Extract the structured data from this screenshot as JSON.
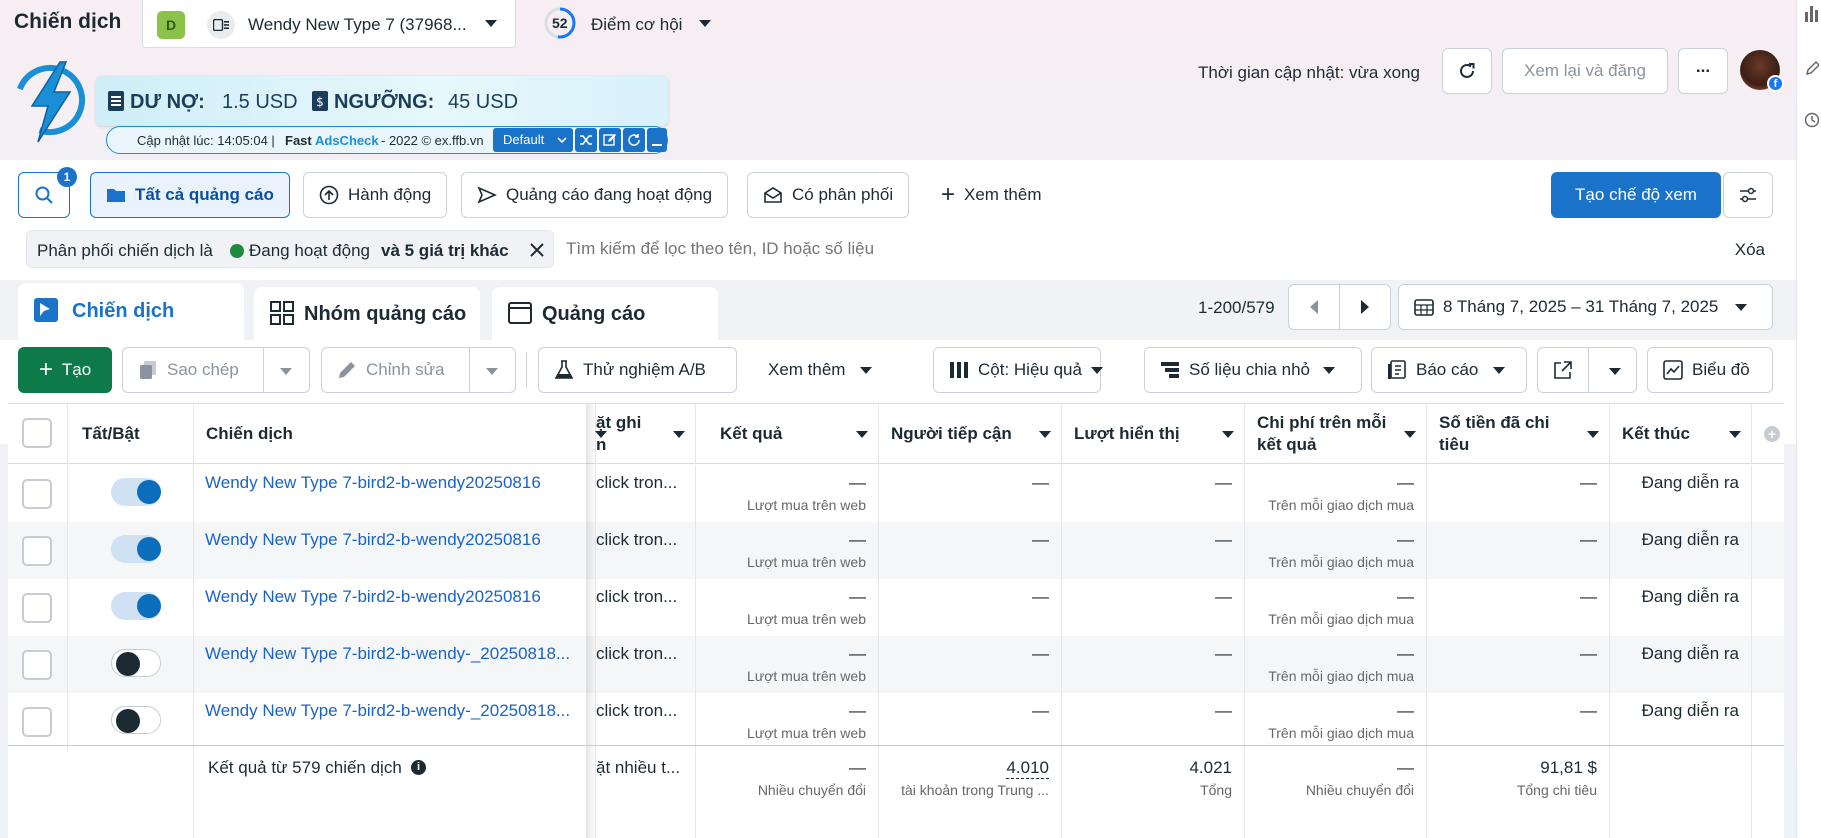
{
  "header": {
    "title": "Chiến dịch",
    "account_initial": "D",
    "account_name": "Wendy New Type 7 (37968...",
    "opportunity_score": "52",
    "opportunity_label": "Điểm cơ hội",
    "update_time": "Thời gian cập nhật: vừa xong",
    "review_publish": "Xem lại và đăng",
    "more": "..."
  },
  "adscheck": {
    "debt_label": "DƯ NỢ:",
    "debt_value": "1.5 USD",
    "threshold_label": "NGƯỠNG:",
    "threshold_value": "45 USD",
    "updated": "Cập nhật lúc: 14:05:04 |",
    "brand_fast": "Fast",
    "brand_ads": "AdsCheck",
    "brand_rest": "- 2022 © ex.ffb.vn",
    "preset": "Default"
  },
  "filters": {
    "search_badge": "1",
    "all_ads": "Tất cả quảng cáo",
    "actions": "Hành động",
    "active_ads": "Quảng cáo đang hoạt động",
    "delivering": "Có phân phối",
    "see_more": "Xem thêm",
    "create_view": "Tạo chế độ xem",
    "chip_prefix": "Phân phối chiến dịch là",
    "chip_status": "Đang hoạt động",
    "chip_suffix": "và 5 giá trị khác",
    "search_placeholder": "Tìm kiếm để lọc theo tên, ID hoặc số liệu",
    "clear": "Xóa"
  },
  "tabs": {
    "campaigns": "Chiến dịch",
    "adsets": "Nhóm quảng cáo",
    "ads": "Quảng cáo",
    "range": "1-200/579",
    "date_range": "8 Tháng 7, 2025 – 31 Tháng 7, 2025"
  },
  "toolbar": {
    "create": "Tạo",
    "copy": "Sao chép",
    "edit": "Chỉnh sửa",
    "ab_test": "Thử nghiệm A/B",
    "more": "Xem thêm",
    "columns": "Cột: Hiệu quả",
    "breakdown": "Số liệu chia nhỏ",
    "reports": "Báo cáo",
    "chart": "Biểu đồ"
  },
  "table": {
    "headers": {
      "toggle": "Tất/Bật",
      "campaign": "Chiến dịch",
      "setting_a": "ặt ghi",
      "setting_b": "n",
      "results": "Kết quả",
      "reach": "Người tiếp cận",
      "impressions": "Lượt hiển thị",
      "cpr_a": "Chi phí trên mỗi",
      "cpr_b": "kết quả",
      "spent_a": "Số tiền đã chi",
      "spent_b": "tiêu",
      "end": "Kết thúc"
    },
    "rows": [
      {
        "name": "Wendy New Type 7-bird2-b-wendy20250816",
        "setting": "click tron...",
        "result": "—",
        "result_sub": "Lượt mua trên web",
        "reach": "—",
        "impr": "—",
        "cpr": "—",
        "cpr_sub": "Trên mỗi giao dịch mua",
        "spent": "—",
        "end": "Đang diễn ra"
      },
      {
        "name": "Wendy New Type 7-bird2-b-wendy20250816",
        "setting": "click tron...",
        "result": "—",
        "result_sub": "Lượt mua trên web",
        "reach": "—",
        "impr": "—",
        "cpr": "—",
        "cpr_sub": "Trên mỗi giao dịch mua",
        "spent": "—",
        "end": "Đang diễn ra"
      },
      {
        "name": "Wendy New Type 7-bird2-b-wendy20250816",
        "setting": "click tron...",
        "result": "—",
        "result_sub": "Lượt mua trên web",
        "reach": "—",
        "impr": "—",
        "cpr": "—",
        "cpr_sub": "Trên mỗi giao dịch mua",
        "spent": "—",
        "end": "Đang diễn ra"
      },
      {
        "name": "Wendy New Type 7-bird2-b-wendy-_20250818...",
        "setting": "click tron...",
        "result": "—",
        "result_sub": "Lượt mua trên web",
        "reach": "—",
        "impr": "—",
        "cpr": "—",
        "cpr_sub": "Trên mỗi giao dịch mua",
        "spent": "—",
        "end": "Đang diễn ra"
      },
      {
        "name": "Wendy New Type 7-bird2-b-wendy-_20250818...",
        "setting": "click tron...",
        "result": "—",
        "result_sub": "Lượt mua trên web",
        "reach": "—",
        "impr": "—",
        "cpr": "—",
        "cpr_sub": "Trên mỗi giao dịch mua",
        "spent": "—",
        "end": "Đang diễn ra"
      }
    ],
    "summary": {
      "label": "Kết quả từ 579 chiến dịch",
      "setting": "ặt nhiều t...",
      "result": "—",
      "result_sub": "Nhiều chuyển đổi",
      "reach": "4.010",
      "reach_sub": "tài khoản trong Trung ...",
      "impr": "4.021",
      "impr_sub": "Tổng",
      "cpr": "—",
      "cpr_sub": "Nhiều chuyển đổi",
      "spent": "91,81 $",
      "spent_sub": "Tổng chi tiêu"
    }
  }
}
